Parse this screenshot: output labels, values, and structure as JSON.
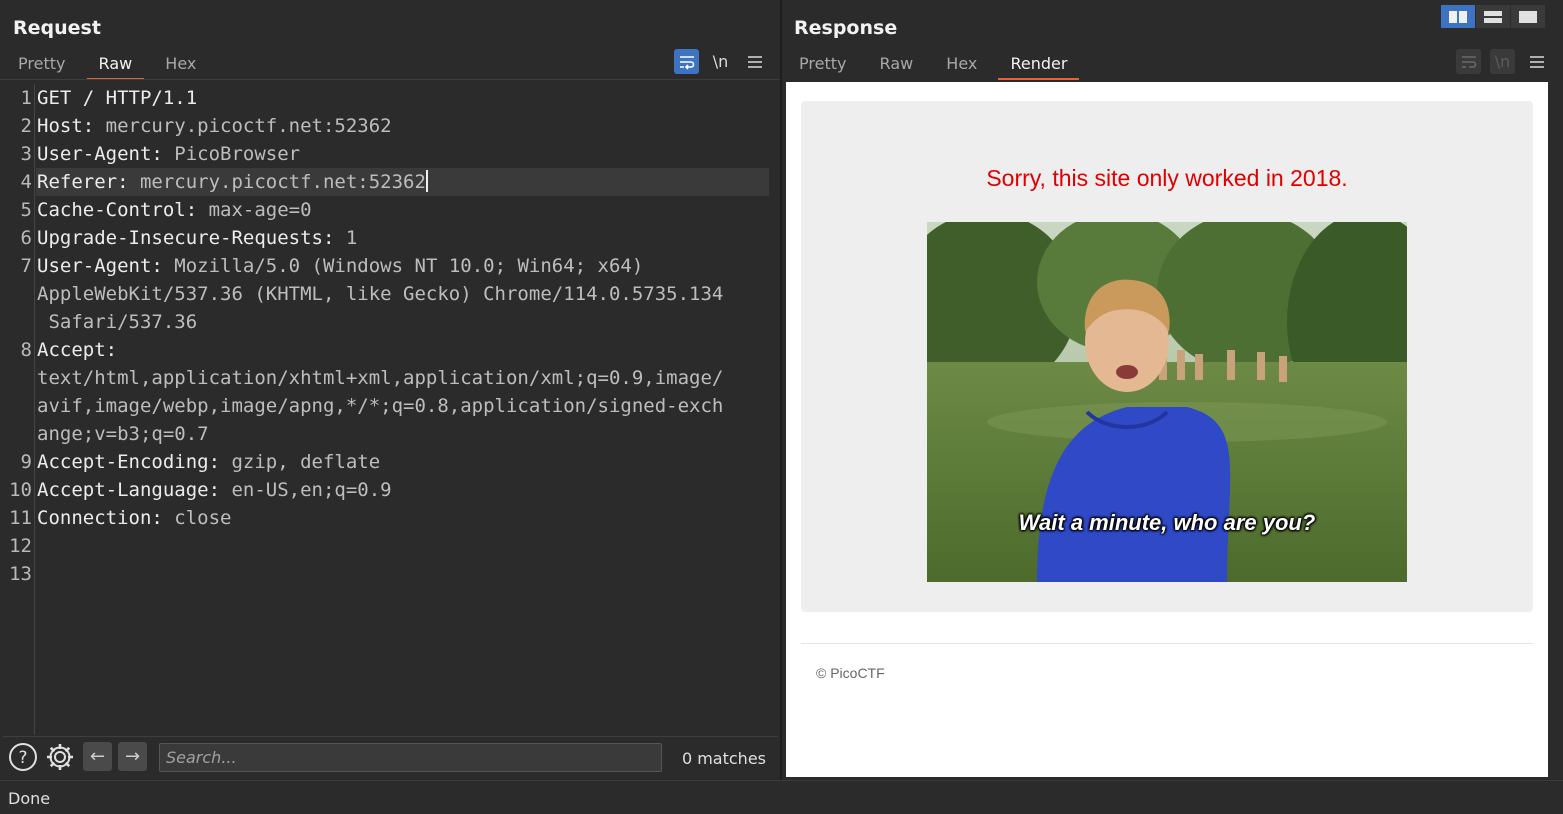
{
  "request": {
    "title": "Request",
    "tabs": [
      "Pretty",
      "Raw",
      "Hex"
    ],
    "active_tab": "Raw",
    "icons": [
      "wrap-lines-icon",
      "newline-icon",
      "menu-icon"
    ],
    "newline_label": "\\n",
    "lines": [
      {
        "n": "1",
        "key": "GET / HTTP/1.1",
        "val": ""
      },
      {
        "n": "2",
        "key": "Host:",
        "val": " mercury.picoctf.net:52362"
      },
      {
        "n": "3",
        "key": "User-Agent:",
        "val": " PicoBrowser"
      },
      {
        "n": "4",
        "key": "Referer:",
        "val": " mercury.picoctf.net:52362"
      },
      {
        "n": "5",
        "key": "Cache-Control:",
        "val": " max-age=0"
      },
      {
        "n": "6",
        "key": "Upgrade-Insecure-Requests:",
        "val": " 1"
      },
      {
        "n": "7",
        "key": "User-Agent:",
        "val": " Mozilla/5.0 (Windows NT 10.0; Win64; x64)"
      },
      {
        "n": "",
        "key": "",
        "val": "AppleWebKit/537.36 (KHTML, like Gecko) Chrome/114.0.5735.134"
      },
      {
        "n": "",
        "key": "",
        "val": " Safari/537.36"
      },
      {
        "n": "8",
        "key": "Accept:",
        "val": ""
      },
      {
        "n": "",
        "key": "",
        "val": "text/html,application/xhtml+xml,application/xml;q=0.9,image/"
      },
      {
        "n": "",
        "key": "",
        "val": "avif,image/webp,image/apng,*/*;q=0.8,application/signed-exch"
      },
      {
        "n": "",
        "key": "",
        "val": "ange;v=b3;q=0.7"
      },
      {
        "n": "9",
        "key": "Accept-Encoding:",
        "val": " gzip, deflate"
      },
      {
        "n": "10",
        "key": "Accept-Language:",
        "val": " en-US,en;q=0.9"
      },
      {
        "n": "11",
        "key": "Connection:",
        "val": " close"
      },
      {
        "n": "12",
        "key": "",
        "val": ""
      },
      {
        "n": "13",
        "key": "",
        "val": ""
      }
    ],
    "search": {
      "placeholder": "Search...",
      "value": "",
      "matches": "0 matches"
    }
  },
  "response": {
    "title": "Response",
    "tabs": [
      "Pretty",
      "Raw",
      "Hex",
      "Render"
    ],
    "active_tab": "Render",
    "render": {
      "message": "Sorry, this site only worked in 2018.",
      "gif_caption": "Wait a minute, who are you?",
      "footer": "© PicoCTF"
    }
  },
  "layout_buttons": [
    "side-by-side",
    "stacked",
    "single"
  ],
  "status": "Done",
  "colors": {
    "accent": "#e8642c",
    "toggle_on": "#3d74c2",
    "sorry_red": "#e00000"
  }
}
